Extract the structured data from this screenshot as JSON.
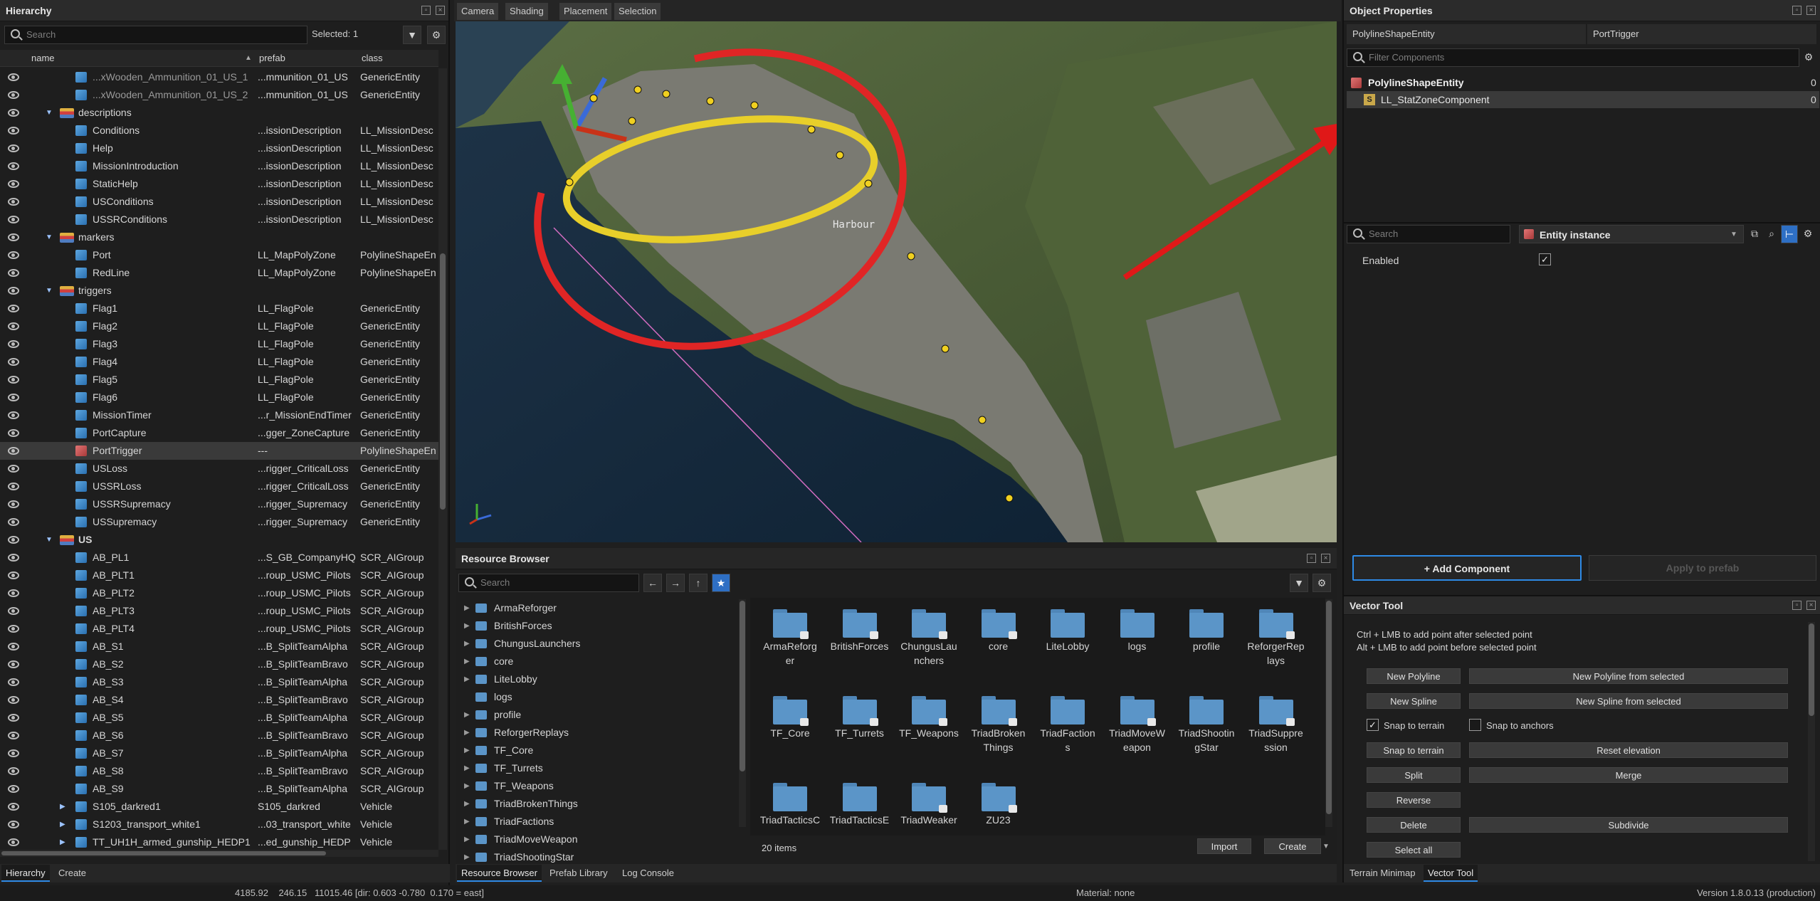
{
  "hierarchy": {
    "title": "Hierarchy",
    "search_placeholder": "Search",
    "selected": "Selected: 1",
    "columns": {
      "name": "name",
      "prefab": "prefab",
      "class": "class"
    },
    "rows": [
      {
        "name": "...xWooden_Ammunition_01_US_1",
        "prefab": "...mmunition_01_US",
        "cls": "GenericEntity",
        "indent": 2,
        "icon": "cube-icon"
      },
      {
        "name": "...xWooden_Ammunition_01_US_2",
        "prefab": "...mmunition_01_US",
        "cls": "GenericEntity",
        "indent": 2,
        "icon": "cube-icon"
      },
      {
        "name": "descriptions",
        "prefab": "",
        "cls": "",
        "indent": 1,
        "icon": "layer-icon",
        "expanded": true
      },
      {
        "name": "Conditions",
        "prefab": "...issionDescription",
        "cls": "LL_MissionDesc",
        "indent": 2,
        "icon": "cube-icon"
      },
      {
        "name": "Help",
        "prefab": "...issionDescription",
        "cls": "LL_MissionDesc",
        "indent": 2,
        "icon": "cube-icon"
      },
      {
        "name": "MissionIntroduction",
        "prefab": "...issionDescription",
        "cls": "LL_MissionDesc",
        "indent": 2,
        "icon": "cube-icon"
      },
      {
        "name": "StaticHelp",
        "prefab": "...issionDescription",
        "cls": "LL_MissionDesc",
        "indent": 2,
        "icon": "cube-icon"
      },
      {
        "name": "USConditions",
        "prefab": "...issionDescription",
        "cls": "LL_MissionDesc",
        "indent": 2,
        "icon": "cube-icon"
      },
      {
        "name": "USSRConditions",
        "prefab": "...issionDescription",
        "cls": "LL_MissionDesc",
        "indent": 2,
        "icon": "cube-icon"
      },
      {
        "name": "markers",
        "prefab": "",
        "cls": "",
        "indent": 1,
        "icon": "layer-icon",
        "expanded": true
      },
      {
        "name": "Port",
        "prefab": "LL_MapPolyZone",
        "cls": "PolylineShapeEn",
        "indent": 2,
        "icon": "cube-icon"
      },
      {
        "name": "RedLine",
        "prefab": "LL_MapPolyZone",
        "cls": "PolylineShapeEn",
        "indent": 2,
        "icon": "cube-icon"
      },
      {
        "name": "triggers",
        "prefab": "",
        "cls": "",
        "indent": 1,
        "icon": "layer-icon",
        "expanded": true
      },
      {
        "name": "Flag1",
        "prefab": "LL_FlagPole",
        "cls": "GenericEntity",
        "indent": 2,
        "icon": "cube-icon"
      },
      {
        "name": "Flag2",
        "prefab": "LL_FlagPole",
        "cls": "GenericEntity",
        "indent": 2,
        "icon": "cube-icon"
      },
      {
        "name": "Flag3",
        "prefab": "LL_FlagPole",
        "cls": "GenericEntity",
        "indent": 2,
        "icon": "cube-icon"
      },
      {
        "name": "Flag4",
        "prefab": "LL_FlagPole",
        "cls": "GenericEntity",
        "indent": 2,
        "icon": "cube-icon"
      },
      {
        "name": "Flag5",
        "prefab": "LL_FlagPole",
        "cls": "GenericEntity",
        "indent": 2,
        "icon": "cube-icon"
      },
      {
        "name": "Flag6",
        "prefab": "LL_FlagPole",
        "cls": "GenericEntity",
        "indent": 2,
        "icon": "cube-icon"
      },
      {
        "name": "MissionTimer",
        "prefab": "...r_MissionEndTimer",
        "cls": "GenericEntity",
        "indent": 2,
        "icon": "cube-icon"
      },
      {
        "name": "PortCapture",
        "prefab": "...gger_ZoneCapture",
        "cls": "GenericEntity",
        "indent": 2,
        "icon": "cube-icon"
      },
      {
        "name": "PortTrigger",
        "prefab": "---",
        "cls": "PolylineShapeEn",
        "indent": 2,
        "icon": "cube-icon-red",
        "selected": true
      },
      {
        "name": "USLoss",
        "prefab": "...rigger_CriticalLoss",
        "cls": "GenericEntity",
        "indent": 2,
        "icon": "cube-icon"
      },
      {
        "name": "USSRLoss",
        "prefab": "...rigger_CriticalLoss",
        "cls": "GenericEntity",
        "indent": 2,
        "icon": "cube-icon"
      },
      {
        "name": "USSRSupremacy",
        "prefab": "...rigger_Supremacy",
        "cls": "GenericEntity",
        "indent": 2,
        "icon": "cube-icon"
      },
      {
        "name": "USSupremacy",
        "prefab": "...rigger_Supremacy",
        "cls": "GenericEntity",
        "indent": 2,
        "icon": "cube-icon"
      },
      {
        "name": "US",
        "prefab": "",
        "cls": "",
        "indent": 1,
        "icon": "layer-icon",
        "expanded": true,
        "bold": true
      },
      {
        "name": "AB_PL1",
        "prefab": "...S_GB_CompanyHQ",
        "cls": "SCR_AIGroup",
        "indent": 2,
        "icon": "cube-icon"
      },
      {
        "name": "AB_PLT1",
        "prefab": "...roup_USMC_Pilots",
        "cls": "SCR_AIGroup",
        "indent": 2,
        "icon": "cube-icon"
      },
      {
        "name": "AB_PLT2",
        "prefab": "...roup_USMC_Pilots",
        "cls": "SCR_AIGroup",
        "indent": 2,
        "icon": "cube-icon"
      },
      {
        "name": "AB_PLT3",
        "prefab": "...roup_USMC_Pilots",
        "cls": "SCR_AIGroup",
        "indent": 2,
        "icon": "cube-icon"
      },
      {
        "name": "AB_PLT4",
        "prefab": "...roup_USMC_Pilots",
        "cls": "SCR_AIGroup",
        "indent": 2,
        "icon": "cube-icon"
      },
      {
        "name": "AB_S1",
        "prefab": "...B_SplitTeamAlpha",
        "cls": "SCR_AIGroup",
        "indent": 2,
        "icon": "cube-icon"
      },
      {
        "name": "AB_S2",
        "prefab": "...B_SplitTeamBravo",
        "cls": "SCR_AIGroup",
        "indent": 2,
        "icon": "cube-icon"
      },
      {
        "name": "AB_S3",
        "prefab": "...B_SplitTeamAlpha",
        "cls": "SCR_AIGroup",
        "indent": 2,
        "icon": "cube-icon"
      },
      {
        "name": "AB_S4",
        "prefab": "...B_SplitTeamBravo",
        "cls": "SCR_AIGroup",
        "indent": 2,
        "icon": "cube-icon"
      },
      {
        "name": "AB_S5",
        "prefab": "...B_SplitTeamAlpha",
        "cls": "SCR_AIGroup",
        "indent": 2,
        "icon": "cube-icon"
      },
      {
        "name": "AB_S6",
        "prefab": "...B_SplitTeamBravo",
        "cls": "SCR_AIGroup",
        "indent": 2,
        "icon": "cube-icon"
      },
      {
        "name": "AB_S7",
        "prefab": "...B_SplitTeamAlpha",
        "cls": "SCR_AIGroup",
        "indent": 2,
        "icon": "cube-icon"
      },
      {
        "name": "AB_S8",
        "prefab": "...B_SplitTeamBravo",
        "cls": "SCR_AIGroup",
        "indent": 2,
        "icon": "cube-icon"
      },
      {
        "name": "AB_S9",
        "prefab": "...B_SplitTeamAlpha",
        "cls": "SCR_AIGroup",
        "indent": 2,
        "icon": "cube-icon"
      },
      {
        "name": "S105_darkred1",
        "prefab": "S105_darkred",
        "cls": "Vehicle",
        "indent": 2,
        "icon": "cube-icon",
        "collapsed": true
      },
      {
        "name": "S1203_transport_white1",
        "prefab": "...03_transport_white",
        "cls": "Vehicle",
        "indent": 2,
        "icon": "cube-icon",
        "collapsed": true
      },
      {
        "name": "TT_UH1H_armed_gunship_HEDP1",
        "prefab": "...ed_gunship_HEDP",
        "cls": "Vehicle",
        "indent": 2,
        "icon": "cube-icon",
        "collapsed": true
      }
    ],
    "bottom_tabs": [
      "Hierarchy",
      "Create"
    ]
  },
  "viewport": {
    "tabs": [
      "Camera",
      "Shading",
      "Placement",
      "Selection"
    ],
    "label": "Harbour"
  },
  "resource_browser": {
    "title": "Resource Browser",
    "search_placeholder": "Search",
    "tree": [
      {
        "name": "ArmaReforger",
        "arrow": true
      },
      {
        "name": "BritishForces",
        "arrow": true
      },
      {
        "name": "ChungusLaunchers",
        "arrow": true
      },
      {
        "name": "core",
        "arrow": true
      },
      {
        "name": "LiteLobby",
        "arrow": true
      },
      {
        "name": "logs",
        "arrow": false
      },
      {
        "name": "profile",
        "arrow": true
      },
      {
        "name": "ReforgerReplays",
        "arrow": true
      },
      {
        "name": "TF_Core",
        "arrow": true
      },
      {
        "name": "TF_Turrets",
        "arrow": true
      },
      {
        "name": "TF_Weapons",
        "arrow": true
      },
      {
        "name": "TriadBrokenThings",
        "arrow": true
      },
      {
        "name": "TriadFactions",
        "arrow": true
      },
      {
        "name": "TriadMoveWeapon",
        "arrow": true
      },
      {
        "name": "TriadShootingStar",
        "arrow": true
      }
    ],
    "folders": [
      {
        "l1": "ArmaReforg",
        "l2": "er",
        "lock": true
      },
      {
        "l1": "BritishForces",
        "l2": "",
        "lock": true
      },
      {
        "l1": "ChungusLau",
        "l2": "nchers",
        "lock": true
      },
      {
        "l1": "core",
        "l2": "",
        "lock": true
      },
      {
        "l1": "LiteLobby",
        "l2": "",
        "lock": false
      },
      {
        "l1": "logs",
        "l2": "",
        "lock": false
      },
      {
        "l1": "profile",
        "l2": "",
        "lock": false
      },
      {
        "l1": "ReforgerRep",
        "l2": "lays",
        "lock": true
      },
      {
        "l1": "TF_Core",
        "l2": "",
        "lock": true
      },
      {
        "l1": "TF_Turrets",
        "l2": "",
        "lock": true
      },
      {
        "l1": "TF_Weapons",
        "l2": "",
        "lock": true
      },
      {
        "l1": "TriadBroken",
        "l2": "Things",
        "lock": true
      },
      {
        "l1": "TriadFaction",
        "l2": "s",
        "lock": false
      },
      {
        "l1": "TriadMoveW",
        "l2": "eapon",
        "lock": true
      },
      {
        "l1": "TriadShootin",
        "l2": "gStar",
        "lock": false
      },
      {
        "l1": "TriadSuppre",
        "l2": "ssion",
        "lock": true
      },
      {
        "l1": "TriadTacticsC",
        "l2": "",
        "lock": false
      },
      {
        "l1": "TriadTacticsE",
        "l2": "",
        "lock": false
      },
      {
        "l1": "TriadWeaker",
        "l2": "",
        "lock": true
      },
      {
        "l1": "ZU23",
        "l2": "",
        "lock": true
      }
    ],
    "item_count": "20 items",
    "import_label": "Import",
    "create_label": "Create",
    "bottom_tabs": [
      "Resource Browser",
      "Prefab Library",
      "Log Console"
    ]
  },
  "object_properties": {
    "title": "Object Properties",
    "entity_type": "PolylineShapeEntity",
    "entity_name": "PortTrigger",
    "filter_placeholder": "Filter Components",
    "components": [
      {
        "name": "PolylineShapeEntity",
        "count": "0"
      },
      {
        "name": "LL_StatZoneComponent",
        "count": "0"
      }
    ],
    "search_placeholder": "Search",
    "instance_dropdown": "Entity instance",
    "enabled_label": "Enabled",
    "add_component": "+ Add Component",
    "apply_prefab": "Apply to prefab"
  },
  "vector_tool": {
    "title": "Vector Tool",
    "hint1": "Ctrl + LMB to add point after selected point",
    "hint2": "Alt + LMB to add point before selected point",
    "new_polyline": "New Polyline",
    "new_polyline_selected": "New Polyline from selected",
    "new_spline": "New Spline",
    "new_spline_selected": "New Spline from selected",
    "snap_terrain": "Snap to terrain",
    "snap_anchors": "Snap to anchors",
    "snap_to_terrain_btn": "Snap to terrain",
    "reset_elevation": "Reset elevation",
    "split": "Split",
    "merge": "Merge",
    "reverse": "Reverse",
    "delete": "Delete",
    "subdivide": "Subdivide",
    "select_all": "Select all",
    "bottom_tabs": [
      "Terrain Minimap",
      "Vector Tool"
    ]
  },
  "status_bar": {
    "coords": "4185.92    246.15   11015.46 [dir: 0.603 -0.780  0.170 = east]",
    "material": "Material: none",
    "version": "Version 1.8.0.13 (production)"
  },
  "colors": {
    "accent": "#2e8ae6",
    "selected_row": "#3a3a3a",
    "zone_red": "#e02020",
    "zone_yellow": "#f0d020"
  }
}
